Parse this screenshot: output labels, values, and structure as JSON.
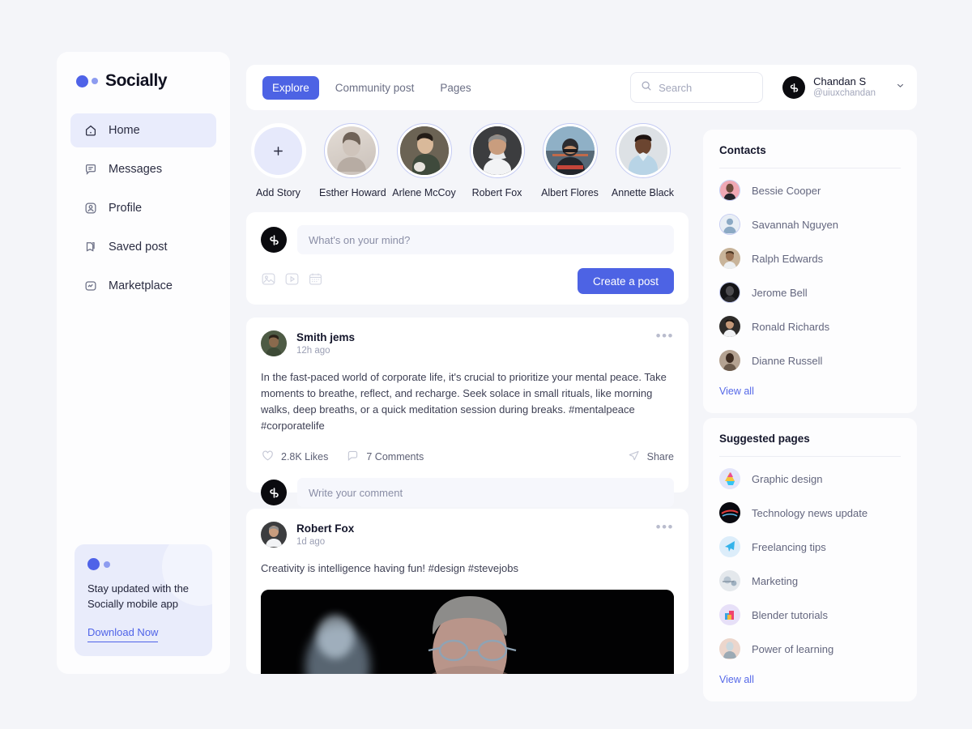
{
  "brand": {
    "name": "Socially"
  },
  "sidebar": {
    "items": [
      {
        "label": "Home",
        "icon": "home-icon",
        "active": true
      },
      {
        "label": "Messages",
        "icon": "message-icon",
        "active": false
      },
      {
        "label": "Profile",
        "icon": "profile-icon",
        "active": false
      },
      {
        "label": "Saved post",
        "icon": "bookmark-icon",
        "active": false
      },
      {
        "label": "Marketplace",
        "icon": "marketplace-icon",
        "active": false
      }
    ],
    "promo": {
      "text": "Stay updated with the Socially mobile app",
      "link": "Download Now"
    }
  },
  "topbar": {
    "tabs": [
      {
        "label": "Explore",
        "active": true
      },
      {
        "label": "Community post",
        "active": false
      },
      {
        "label": "Pages",
        "active": false
      }
    ],
    "search": {
      "placeholder": "Search",
      "value": ""
    },
    "user": {
      "name": "Chandan S",
      "handle": "@uiuxchandan"
    }
  },
  "stories": [
    {
      "name": "Add Story",
      "type": "add"
    },
    {
      "name": "Esther Howard",
      "type": "photo",
      "tone": "#d8d2cd"
    },
    {
      "name": "Arlene McCoy",
      "type": "photo",
      "tone": "#6f6a5d"
    },
    {
      "name": "Robert Fox",
      "type": "photo",
      "tone": "#4a4a4c"
    },
    {
      "name": "Albert Flores",
      "type": "photo",
      "tone": "#7d94a6"
    },
    {
      "name": "Annette Black",
      "type": "photo",
      "tone": "#cfd4d8"
    }
  ],
  "composer": {
    "placeholder": "What's on your mind?",
    "icons": [
      "image-icon",
      "video-icon",
      "calendar-icon"
    ],
    "button": "Create a post"
  },
  "posts": [
    {
      "author": "Smith jems",
      "time": "12h ago",
      "body": "In the fast-paced world of corporate life, it's crucial to prioritize your mental peace. Take moments to breathe, reflect, and recharge. Seek solace in small rituals, like morning walks, deep breaths, or a quick meditation session during breaks. #mentalpeace #corporatelife",
      "likes": "2.8K Likes",
      "comments": "7 Comments",
      "share": "Share",
      "comment_placeholder": "Write your comment",
      "has_media": false
    },
    {
      "author": "Robert Fox",
      "time": "1d ago",
      "body": "Creativity is intelligence having fun! #design #stevejobs",
      "likes": "",
      "comments": "",
      "share": "",
      "comment_placeholder": "",
      "has_media": true
    }
  ],
  "contacts": {
    "title": "Contacts",
    "items": [
      {
        "name": "Bessie Cooper",
        "tone": "#efa3b0"
      },
      {
        "name": "Savannah Nguyen",
        "tone": "#b9cde2"
      },
      {
        "name": "Ralph Edwards",
        "tone": "#b6a48d"
      },
      {
        "name": "Jerome Bell",
        "tone": "#2a2a2e"
      },
      {
        "name": "Ronald Richards",
        "tone": "#4e4a47"
      },
      {
        "name": "Dianne Russell",
        "tone": "#7e6d5f"
      }
    ],
    "view_all": "View all"
  },
  "pages": {
    "title": "Suggested pages",
    "items": [
      {
        "name": "Graphic design",
        "tone": "#dfe3fb"
      },
      {
        "name": "Technology news update",
        "tone": "#101018"
      },
      {
        "name": "Freelancing tips",
        "tone": "#dbeefb"
      },
      {
        "name": "Marketing",
        "tone": "#dfe4ea"
      },
      {
        "name": "Blender tutorials",
        "tone": "#e4def7"
      },
      {
        "name": "Power of learning",
        "tone": "#e6cfc6"
      }
    ],
    "view_all": "View all"
  },
  "colors": {
    "accent": "#4d63e4",
    "accent_soft": "#e9ecfc",
    "page_bg": "#f4f5f9",
    "card_bg": "#ffffff",
    "text": "#14162b",
    "muted": "#8a8ea6"
  }
}
